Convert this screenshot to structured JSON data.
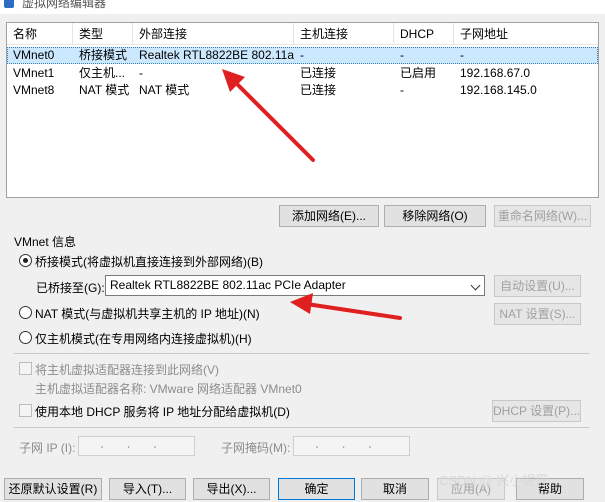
{
  "window": {
    "title": "虚拟网络编辑器"
  },
  "table": {
    "columns": [
      "名称",
      "类型",
      "外部连接",
      "主机连接",
      "DHCP",
      "子网地址"
    ],
    "rows": [
      {
        "name": "VMnet0",
        "type": "桥接模式",
        "external": "Realtek RTL8822BE 802.11a...",
        "host": "-",
        "dhcp": "-",
        "subnet": "-"
      },
      {
        "name": "VMnet1",
        "type": "仅主机...",
        "external": "-",
        "host": "已连接",
        "dhcp": "已启用",
        "subnet": "192.168.67.0"
      },
      {
        "name": "VMnet8",
        "type": "NAT 模式",
        "external": "NAT 模式",
        "host": "已连接",
        "dhcp": "-",
        "subnet": "192.168.145.0"
      }
    ]
  },
  "network_buttons": {
    "add": "添加网络(E)...",
    "remove": "移除网络(O)",
    "rename": "重命名网络(W)..."
  },
  "info": {
    "group_label": "VMnet 信息",
    "bridged_label": "桥接模式(将虚拟机直接连接到外部网络)(B)",
    "bridged_to_label": "已桥接至(G):",
    "bridged_to_value": "Realtek RTL8822BE 802.11ac PCIe Adapter",
    "auto_settings": "自动设置(U)...",
    "nat_label": "NAT 模式(与虚拟机共享主机的 IP 地址)(N)",
    "nat_settings": "NAT 设置(S)...",
    "hostonly_label": "仅主机模式(在专用网络内连接虚拟机)(H)",
    "connect_adapter_label": "将主机虚拟适配器连接到此网络(V)",
    "adapter_name_label": "主机虚拟适配器名称: VMware 网络适配器 VMnet0",
    "dhcp_label": "使用本地 DHCP 服务将 IP 地址分配给虚拟机(D)",
    "dhcp_settings": "DHCP 设置(P)...",
    "subnet_ip_label": "子网 IP (I):",
    "subnet_ip_value": "   .   .   .",
    "subnet_mask_label": "子网掩码(M):",
    "subnet_mask_value": "   .   .   ."
  },
  "footer": {
    "restore": "还原默认设置(R)",
    "import": "导入(T)...",
    "export": "导出(X)...",
    "ok": "确定",
    "cancel": "取消",
    "apply": "应用(A)",
    "help": "帮助"
  },
  "watermark": "CSDN @ 兴小妮巴",
  "colors": {
    "selection": "#cce8ff",
    "annotation_arrow": "#e02020",
    "focus_border": "#0078d7"
  }
}
